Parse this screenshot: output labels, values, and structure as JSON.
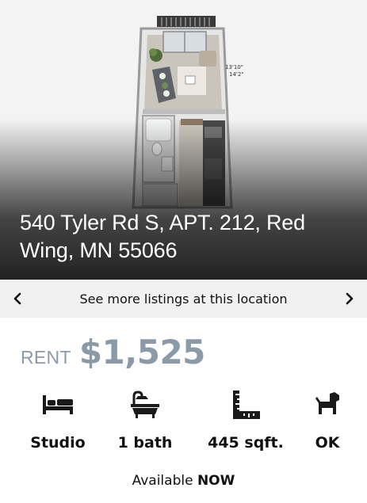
{
  "listing": {
    "address": "540 Tyler Rd S, APT. 212, Red Wing, MN 55066",
    "floorplan_dims": [
      "13'10\"",
      "14'2\""
    ],
    "nav": {
      "prev_icon": "chevron-left-icon",
      "label": "See more listings at this location",
      "next_icon": "chevron-right-icon"
    },
    "rent": {
      "label": "RENT",
      "price": "$1,525"
    },
    "features": [
      {
        "icon": "bed-icon",
        "value": "Studio"
      },
      {
        "icon": "bathtub-icon",
        "value": "1 bath"
      },
      {
        "icon": "ruler-icon",
        "value": "445 sqft."
      },
      {
        "icon": "dog-icon",
        "value": "OK"
      }
    ],
    "availability": {
      "prefix": "Available",
      "status": "NOW"
    },
    "colors": {
      "rent_text": "#8b9aa8",
      "nav_background": "#f1f1f1",
      "text": "#111111"
    }
  }
}
